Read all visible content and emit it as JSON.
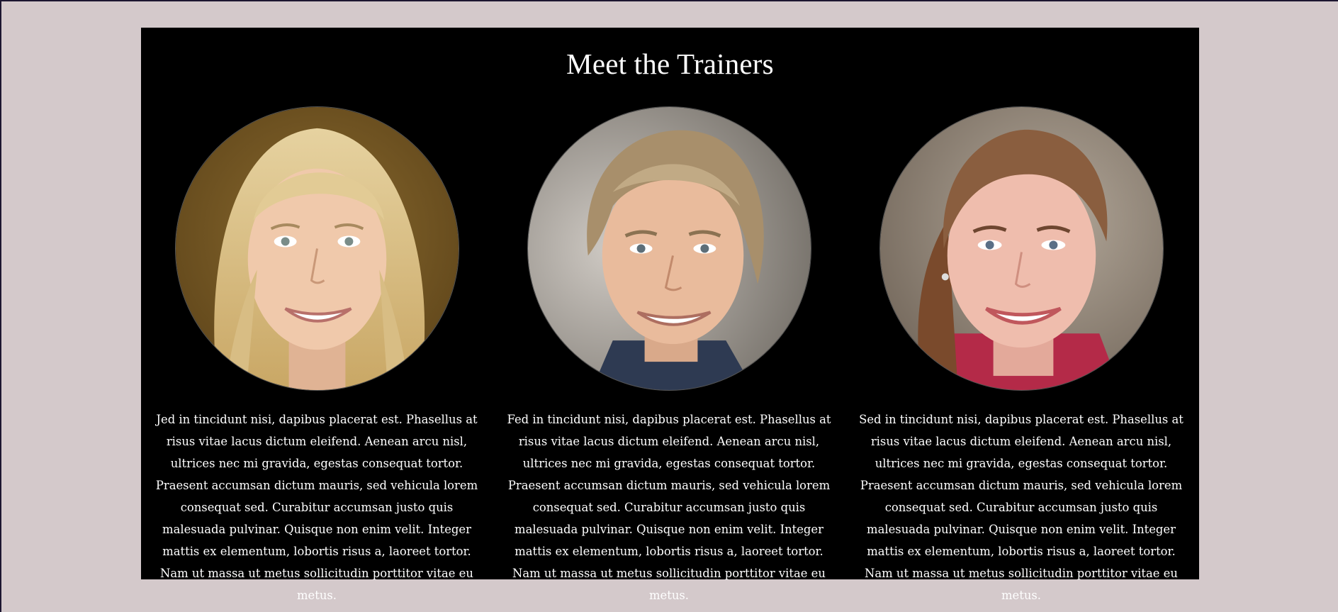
{
  "section": {
    "title": "Meet the Trainers"
  },
  "trainers": [
    {
      "portrait_icon": "person-photo-blonde-woman",
      "bio": "Jed in tincidunt nisi, dapibus placerat est. Phasellus at risus vitae lacus dictum eleifend. Aenean arcu nisl, ultrices nec mi gravida, egestas consequat tortor. Praesent accumsan dictum mauris, sed vehicula lorem consequat sed. Curabitur accumsan justo quis malesuada pulvinar. Quisque non enim velit. Integer mattis ex elementum, lobortis risus a, laoreet tortor. Nam ut massa ut metus sollicitudin porttitor vitae eu metus."
    },
    {
      "portrait_icon": "person-photo-man",
      "bio": "Fed in tincidunt nisi, dapibus placerat est. Phasellus at risus vitae lacus dictum eleifend. Aenean arcu nisl, ultrices nec mi gravida, egestas consequat tortor. Praesent accumsan dictum mauris, sed vehicula lorem consequat sed. Curabitur accumsan justo quis malesuada pulvinar. Quisque non enim velit. Integer mattis ex elementum, lobortis risus a, laoreet tortor. Nam ut massa ut metus sollicitudin porttitor vitae eu metus."
    },
    {
      "portrait_icon": "person-photo-brunette-woman",
      "bio": "Sed in tincidunt nisi, dapibus placerat est. Phasellus at risus vitae lacus dictum eleifend. Aenean arcu nisl, ultrices nec mi gravida, egestas consequat tortor. Praesent accumsan dictum mauris, sed vehicula lorem consequat sed. Curabitur accumsan justo quis malesuada pulvinar. Quisque non enim velit. Integer mattis ex elementum, lobortis risus a, laoreet tortor. Nam ut massa ut metus sollicitudin porttitor vitae eu metus."
    }
  ],
  "colors": {
    "page_bg": "#d4c9cb",
    "panel_bg": "#000000",
    "text": "#ffffff"
  }
}
